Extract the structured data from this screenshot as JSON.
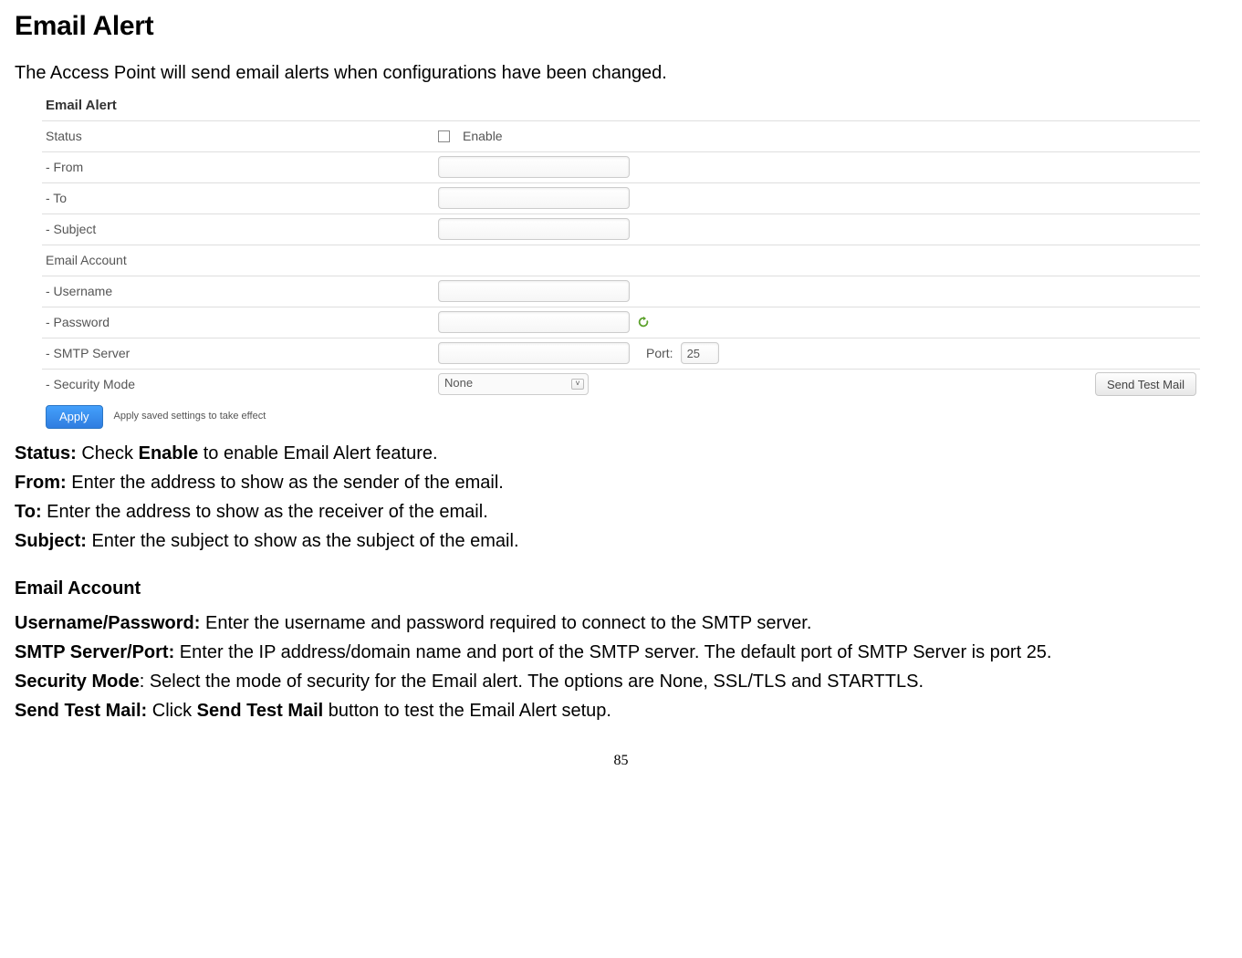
{
  "page": {
    "title": "Email Alert",
    "intro": "The Access Point will send email alerts when configurations have been changed.",
    "number": "85"
  },
  "panel": {
    "heading": "Email Alert",
    "rows": {
      "status_label": "Status",
      "enable_label": "Enable",
      "from_label": "- From",
      "to_label": "- To",
      "subject_label": "- Subject",
      "email_account_label": "Email Account",
      "username_label": "- Username",
      "password_label": "- Password",
      "smtp_label": "- SMTP Server",
      "port_label": "Port:",
      "port_value": "25",
      "security_label": "- Security Mode",
      "security_value": "None",
      "send_test_label": "Send Test Mail"
    },
    "apply": {
      "button": "Apply",
      "hint": "Apply saved settings to take effect"
    }
  },
  "desc": {
    "status_b": "Status:",
    "status_t1": " Check ",
    "status_t2": "Enable",
    "status_t3": " to enable Email Alert feature.",
    "from_b": "From:",
    "from_t": " Enter the address to show as the sender of the email.",
    "to_b": "To:",
    "to_t": " Enter the address to show as the receiver of the email.",
    "subject_b": "Subject:",
    "subject_t": " Enter the subject to show as the subject of the email.",
    "section": "Email Account",
    "up_b": "Username/Password:",
    "up_t": " Enter the username and password required to connect to the SMTP server.",
    "smtp_b": "SMTP Server/Port:",
    "smtp_t": " Enter the IP address/domain name and port of the SMTP server. The default port of SMTP Server is port 25.",
    "sec_b": "Security Mode",
    "sec_t": ": Select the mode of security for the Email alert. The options are None, SSL/TLS and STARTTLS.",
    "test_b": "Send Test Mail:",
    "test_t1": " Click ",
    "test_t2": "Send Test Mail",
    "test_t3": " button to test the Email Alert setup."
  }
}
